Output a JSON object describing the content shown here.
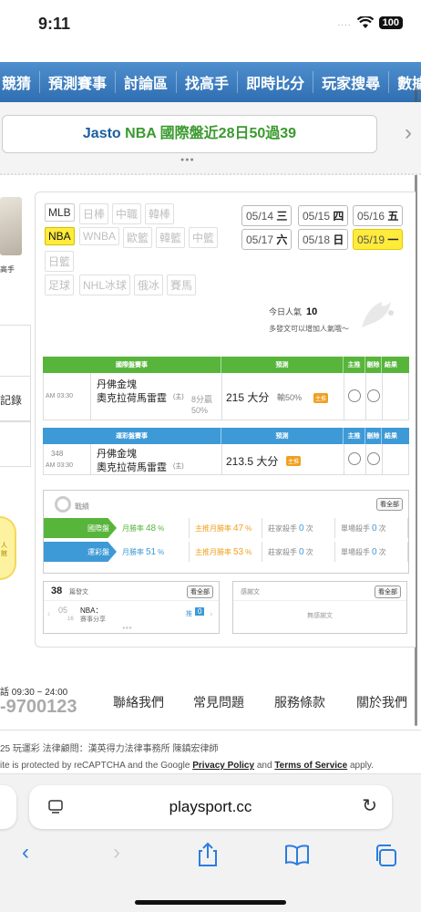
{
  "status": {
    "time": "9:11",
    "signal": "....",
    "battery": "100"
  },
  "nav": {
    "items": [
      "競猜",
      "預測賽事",
      "討論區",
      "找高手",
      "即時比分",
      "玩家搜尋",
      "數據"
    ]
  },
  "banner": {
    "part1": "Jasto ",
    "part2": "NBA 國際盤近28日50過39",
    "arrow": "›"
  },
  "sidebar": {
    "label": "高手",
    "text1": "記錄",
    "bulb_text": "人\n館"
  },
  "leagues": [
    {
      "label": "MLB",
      "state": "normal"
    },
    {
      "label": "日棒",
      "state": "dim"
    },
    {
      "label": "中職",
      "state": "dim"
    },
    {
      "label": "韓棒",
      "state": "dim"
    },
    {
      "label": "NBA",
      "state": "selected"
    },
    {
      "label": "WNBA",
      "state": "dim"
    },
    {
      "label": "歐籃",
      "state": "dim"
    },
    {
      "label": "韓籃",
      "state": "dim"
    },
    {
      "label": "中籃",
      "state": "dim"
    },
    {
      "label": "日籃",
      "state": "dim"
    },
    {
      "label": "足球",
      "state": "dim"
    },
    {
      "label": "NHL冰球",
      "state": "dim"
    },
    {
      "label": "俄冰",
      "state": "dim"
    },
    {
      "label": "賽馬",
      "state": "dim"
    }
  ],
  "dates": [
    {
      "date": "05/14",
      "day": "三"
    },
    {
      "date": "05/15",
      "day": "四"
    },
    {
      "date": "05/16",
      "day": "五"
    },
    {
      "date": "05/17",
      "day": "六"
    },
    {
      "date": "05/18",
      "day": "日"
    },
    {
      "date": "05/19",
      "day": "一",
      "selected": true
    }
  ],
  "popularity": {
    "label": "今日人氣",
    "value": "10",
    "hint": "多發文可以增加人氣哦～"
  },
  "intl_table": {
    "headers": [
      "國際盤賽事",
      "預測",
      "主推",
      "刪除",
      "結果"
    ],
    "row": {
      "time": "AM 03:30",
      "team1": "丹佛金塊",
      "team2": "奧克拉荷馬雷霆",
      "team2_suffix": "(主)",
      "spread": "8分贏",
      "spread_pct": "50%",
      "pred": "215 大分",
      "pred_extra": "輸50%",
      "tag": "主推"
    }
  },
  "lottery_table": {
    "headers": [
      "運彩盤賽事",
      "預測",
      "主推",
      "刪除",
      "結果"
    ],
    "row": {
      "num": "348",
      "time": "AM 03:30",
      "team1": "丹佛金塊",
      "team2": "奧克拉荷馬雷霆",
      "team2_suffix": "(主)",
      "pred": "213.5 大分",
      "tag": "主推"
    }
  },
  "stats": {
    "title": "戰績",
    "btn": "看全部",
    "rows": [
      {
        "label": "國際盤",
        "c1_lbl": "月勝率",
        "c1_val": "48",
        "c2_lbl": "主推月勝率",
        "c2_val": "47",
        "c3_lbl": "莊家殺手",
        "c3_val": "0",
        "c4_lbl": "單場殺手",
        "c4_val": "0",
        "pct": "%",
        "unit": "次"
      },
      {
        "label": "運彩盤",
        "c1_lbl": "月勝率",
        "c1_val": "51",
        "c2_lbl": "主推月勝率",
        "c2_val": "53",
        "c3_lbl": "莊家殺手",
        "c3_val": "0",
        "c4_lbl": "單場殺手",
        "c4_val": "0",
        "pct": "%",
        "unit": "次"
      }
    ],
    "colors": {
      "intl": "#58b53b",
      "lottery": "#3d9ad6",
      "c1": "#3a9a2e",
      "c2": "#f0a020"
    }
  },
  "posts": {
    "count": "38",
    "label": "篇發文",
    "btn": "看全部",
    "date": "05",
    "date_sub": "16",
    "post_title": "NBA：",
    "post_sub": "賽事分享",
    "push_label": "推",
    "push_val": "0"
  },
  "thanks": {
    "label": "感謝文",
    "btn": "看全部",
    "empty": "無感謝文"
  },
  "footer": {
    "phone_label": "話 09:30 ~ 24:00",
    "phone": "-9700123",
    "links": [
      "聯絡我們",
      "常見問題",
      "服務條款",
      "關於我們"
    ],
    "copyright": "25 玩運彩 法律顧問：漢英得力法律事務所 陳鎮宏律師",
    "recaptcha_pre": "ite is protected by reCAPTCHA and the Google ",
    "privacy": "Privacy Policy",
    "and": " and ",
    "terms": "Terms of Service",
    "apply": " apply."
  },
  "browser": {
    "url": "playsport.cc"
  }
}
